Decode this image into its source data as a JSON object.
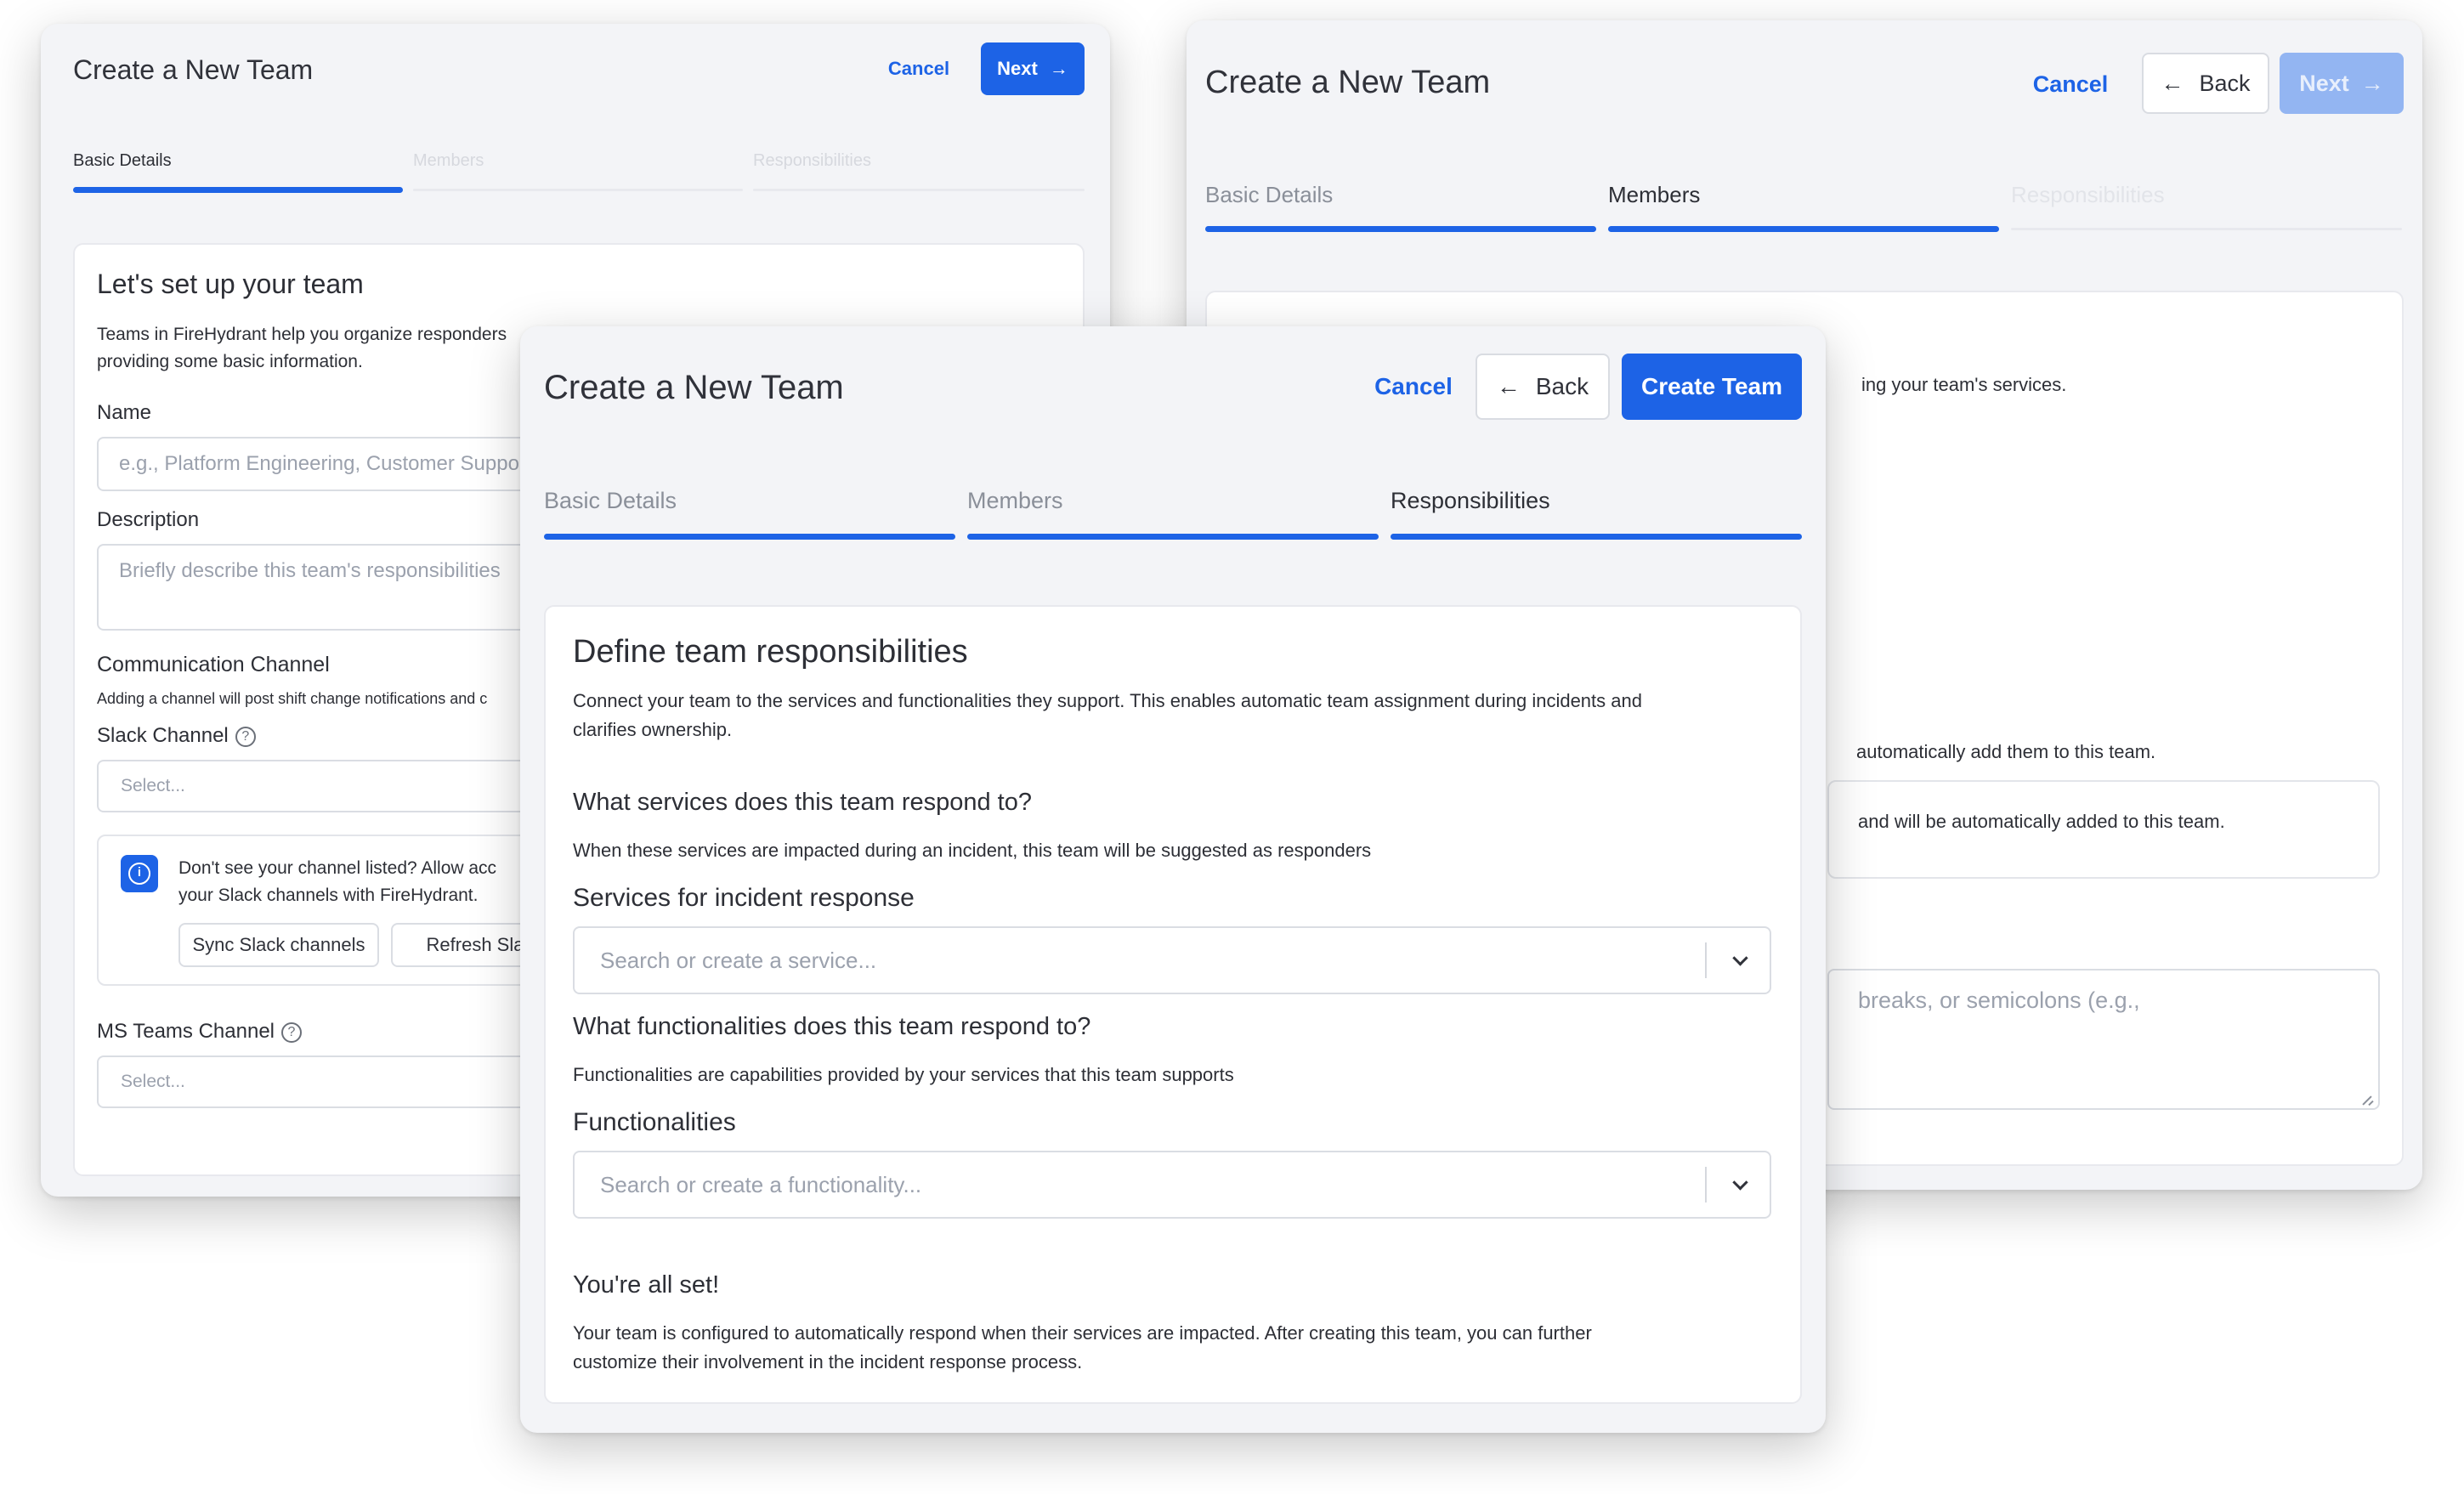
{
  "dialog_left": {
    "title": "Create a New Team",
    "cancel_label": "Cancel",
    "next_label": "Next",
    "tabs": [
      {
        "label": "Basic Details"
      },
      {
        "label": "Members"
      },
      {
        "label": "Responsibilities"
      }
    ],
    "card": {
      "heading": "Let's set up your team",
      "intro_line1": "Teams in FireHydrant help you organize responders",
      "intro_line2": "providing some basic information.",
      "name_label": "Name",
      "name_placeholder": "e.g., Platform Engineering, Customer Support",
      "description_label": "Description",
      "description_placeholder": "Briefly describe this team's responsibilities",
      "comm_heading": "Communication Channel",
      "comm_text": "Adding a channel will post shift change notifications and c",
      "slack_label": "Slack Channel",
      "slack_placeholder": "Select...",
      "info_line1": "Don't see your channel listed? Allow acc",
      "info_line2": "your Slack channels with FireHydrant.",
      "sync_label": "Sync Slack channels",
      "refresh_label": "Refresh Slack",
      "msteams_label": "MS Teams Channel",
      "msteams_placeholder": "Select..."
    }
  },
  "dialog_right": {
    "title": "Create a New Team",
    "cancel_label": "Cancel",
    "back_label": "Back",
    "next_label": "Next",
    "tabs": [
      {
        "label": "Basic Details"
      },
      {
        "label": "Members"
      },
      {
        "label": "Responsibilities"
      }
    ],
    "card": {
      "text1": "ing your team's services.",
      "text2": "automatically add them to this team.",
      "text3": "and will be automatically added to this team.",
      "text4": "breaks, or semicolons (e.g.,"
    }
  },
  "dialog_front": {
    "title": "Create a New Team",
    "cancel_label": "Cancel",
    "back_label": "Back",
    "create_label": "Create Team",
    "tabs": [
      {
        "label": "Basic Details"
      },
      {
        "label": "Members"
      },
      {
        "label": "Responsibilities"
      }
    ],
    "card": {
      "heading": "Define team responsibilities",
      "intro_line1": "Connect your team to the services and functionalities they support. This enables automatic team assignment during incidents and",
      "intro_line2": "clarifies ownership.",
      "services_question": "What services does this team respond to?",
      "services_help": "When these services are impacted during an incident, this team will be suggested as responders",
      "services_label": "Services for incident response",
      "services_placeholder": "Search or create a service...",
      "func_question": "What functionalities does this team respond to?",
      "func_help": "Functionalities are capabilities provided by your services that this team supports",
      "func_label": "Functionalities",
      "func_placeholder": "Search or create a functionality...",
      "done_heading": "You're all set!",
      "done_line1": "Your team is configured to automatically respond when their services are impacted. After creating this team, you can further",
      "done_line2": "customize their involvement in the incident response process."
    }
  }
}
